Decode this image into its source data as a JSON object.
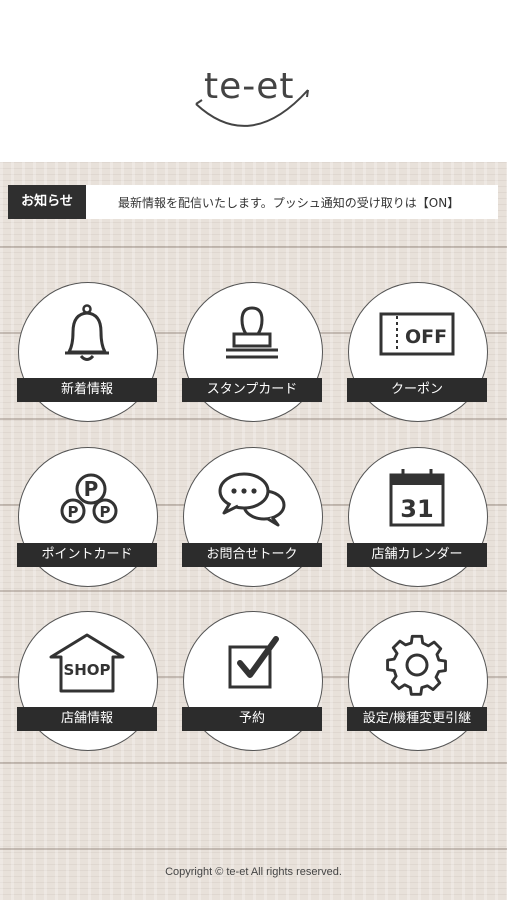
{
  "header": {
    "logo_text": "te-et"
  },
  "notice": {
    "label": "お知らせ",
    "message": "最新情報を配信いたします。プッシュ通知の受け取りは【ON】"
  },
  "menu": {
    "items": [
      {
        "label": "新着情報",
        "icon": "bell-icon"
      },
      {
        "label": "スタンプカード",
        "icon": "stamp-icon"
      },
      {
        "label": "クーポン",
        "icon": "coupon-off-icon",
        "icon_text": "OFF"
      },
      {
        "label": "ポイントカード",
        "icon": "point-coins-icon",
        "icon_text": "P"
      },
      {
        "label": "お問合せトーク",
        "icon": "chat-bubbles-icon"
      },
      {
        "label": "店舗カレンダー",
        "icon": "calendar-icon",
        "icon_text": "31"
      },
      {
        "label": "店舗情報",
        "icon": "shop-house-icon",
        "icon_text": "SHOP"
      },
      {
        "label": "予約",
        "icon": "checkbox-icon"
      },
      {
        "label": "設定/機種変更引継",
        "icon": "gear-icon"
      }
    ]
  },
  "footer": {
    "copyright": "Copyright © te-et All rights reserved."
  },
  "colors": {
    "label_bg": "#2c2c2c",
    "wood": "#e8e1da",
    "text": "#333333"
  }
}
